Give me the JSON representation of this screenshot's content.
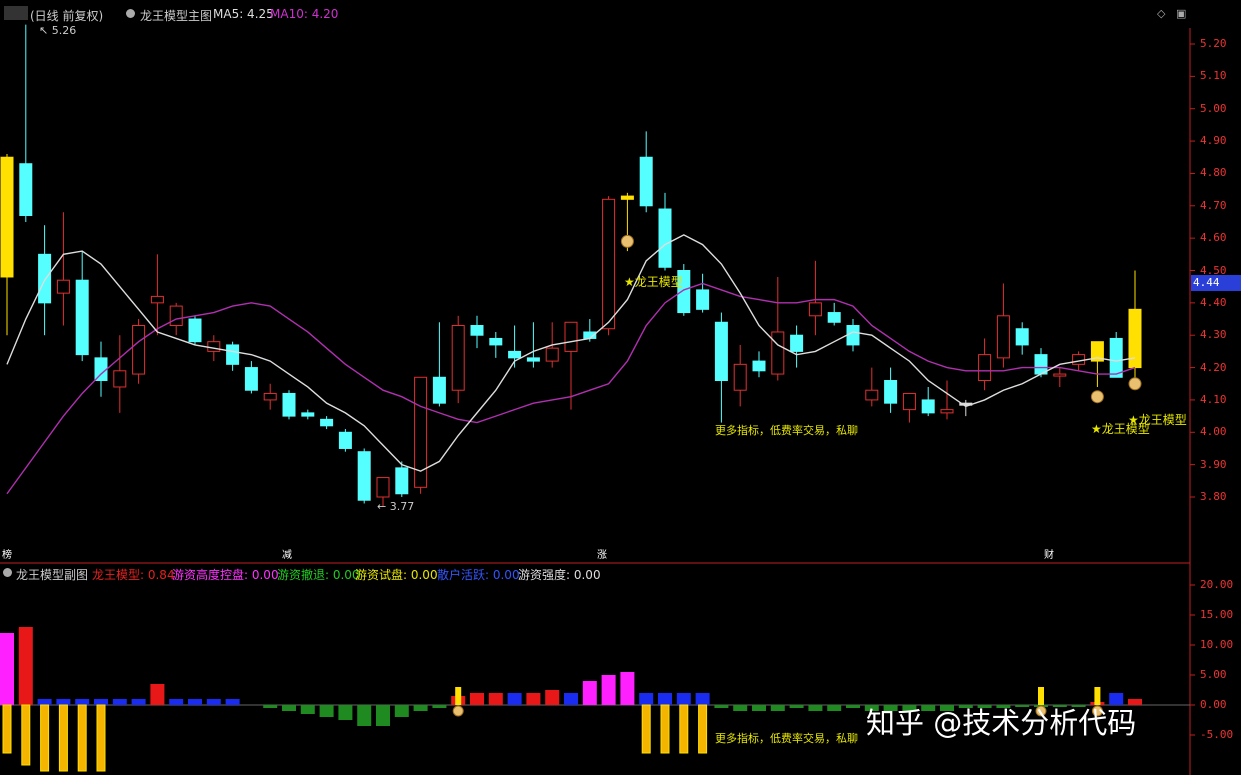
{
  "header": {
    "period_label": "(日线 前复权)",
    "main_chart_title": "龙王模型主图",
    "ma5_label": "MA5: 4.25",
    "ma10_label": "MA10: 4.20"
  },
  "sub_header": {
    "title": "龙王模型副图",
    "items": [
      {
        "label": "龙王模型: 0.84",
        "color": "#e62020"
      },
      {
        "label": "游资高度控盘: 0.00",
        "color": "#ff33ff"
      },
      {
        "label": "游资撤退: 0.00",
        "color": "#22cc22"
      },
      {
        "label": "游资试盘: 0.00",
        "color": "#e6e600"
      },
      {
        "label": "散户活跃: 0.00",
        "color": "#3355ff"
      },
      {
        "label": "游资强度: 0.00",
        "color": "#dddddd"
      }
    ]
  },
  "tags": [
    {
      "text": "榜",
      "color": "#b05050"
    },
    {
      "text": "减",
      "color": "#2e8b2e"
    },
    {
      "text": "涨",
      "color": "#c03030"
    },
    {
      "text": "财",
      "color": "#4a6aa0"
    }
  ],
  "current_price": "4.44",
  "watermark": "知乎 @技术分析代码",
  "annotations": {
    "more_indicators": "更多指标，低费率交易，私聊",
    "dragon_a": "★龙王模型",
    "dragon_b": "★龙王模型",
    "dragon_c": "★龙王模型",
    "high_mark": "5.26",
    "low_mark": "3.77"
  },
  "colors": {
    "up": "#e03030",
    "down": "#55ffff",
    "signal": "#ffe000",
    "ma5": "#dddddd",
    "ma10": "#b030b0",
    "axis": "#c02020"
  },
  "chart_data": [
    {
      "type": "candlestick",
      "title": "龙王模型主图",
      "ylim": [
        3.7,
        5.3
      ],
      "yticks": [
        "5.20",
        "5.10",
        "5.00",
        "4.90",
        "4.80",
        "4.70",
        "4.60",
        "4.50",
        "4.40",
        "4.30",
        "4.20",
        "4.10",
        "4.00",
        "3.90",
        "3.80"
      ],
      "candles": [
        {
          "o": 4.48,
          "h": 4.86,
          "l": 4.3,
          "c": 4.85,
          "k": "signal"
        },
        {
          "o": 4.83,
          "h": 5.26,
          "l": 4.65,
          "c": 4.67,
          "k": "down"
        },
        {
          "o": 4.55,
          "h": 4.64,
          "l": 4.3,
          "c": 4.4,
          "k": "down"
        },
        {
          "o": 4.43,
          "h": 4.68,
          "l": 4.33,
          "c": 4.47,
          "k": "up"
        },
        {
          "o": 4.47,
          "h": 4.56,
          "l": 4.22,
          "c": 4.24,
          "k": "down"
        },
        {
          "o": 4.23,
          "h": 4.28,
          "l": 4.11,
          "c": 4.16,
          "k": "down"
        },
        {
          "o": 4.14,
          "h": 4.3,
          "l": 4.06,
          "c": 4.19,
          "k": "up"
        },
        {
          "o": 4.18,
          "h": 4.35,
          "l": 4.15,
          "c": 4.33,
          "k": "up"
        },
        {
          "o": 4.4,
          "h": 4.55,
          "l": 4.3,
          "c": 4.42,
          "k": "up"
        },
        {
          "o": 4.33,
          "h": 4.4,
          "l": 4.3,
          "c": 4.39,
          "k": "up"
        },
        {
          "o": 4.35,
          "h": 4.36,
          "l": 4.27,
          "c": 4.28,
          "k": "down"
        },
        {
          "o": 4.25,
          "h": 4.3,
          "l": 4.22,
          "c": 4.28,
          "k": "up"
        },
        {
          "o": 4.27,
          "h": 4.28,
          "l": 4.19,
          "c": 4.21,
          "k": "down"
        },
        {
          "o": 4.2,
          "h": 4.22,
          "l": 4.12,
          "c": 4.13,
          "k": "down"
        },
        {
          "o": 4.1,
          "h": 4.15,
          "l": 4.07,
          "c": 4.12,
          "k": "up"
        },
        {
          "o": 4.12,
          "h": 4.13,
          "l": 4.04,
          "c": 4.05,
          "k": "down"
        },
        {
          "o": 4.06,
          "h": 4.07,
          "l": 4.04,
          "c": 4.05,
          "k": "down"
        },
        {
          "o": 4.04,
          "h": 4.05,
          "l": 4.01,
          "c": 4.02,
          "k": "down"
        },
        {
          "o": 4.0,
          "h": 4.01,
          "l": 3.94,
          "c": 3.95,
          "k": "down"
        },
        {
          "o": 3.94,
          "h": 3.95,
          "l": 3.78,
          "c": 3.79,
          "k": "down"
        },
        {
          "o": 3.8,
          "h": 3.86,
          "l": 3.77,
          "c": 3.86,
          "k": "up"
        },
        {
          "o": 3.89,
          "h": 3.91,
          "l": 3.8,
          "c": 3.81,
          "k": "down"
        },
        {
          "o": 3.83,
          "h": 4.17,
          "l": 3.81,
          "c": 4.17,
          "k": "up"
        },
        {
          "o": 4.17,
          "h": 4.34,
          "l": 4.08,
          "c": 4.09,
          "k": "down"
        },
        {
          "o": 4.13,
          "h": 4.36,
          "l": 4.09,
          "c": 4.33,
          "k": "up"
        },
        {
          "o": 4.33,
          "h": 4.36,
          "l": 4.26,
          "c": 4.3,
          "k": "down"
        },
        {
          "o": 4.29,
          "h": 4.31,
          "l": 4.23,
          "c": 4.27,
          "k": "down"
        },
        {
          "o": 4.25,
          "h": 4.33,
          "l": 4.2,
          "c": 4.23,
          "k": "down"
        },
        {
          "o": 4.23,
          "h": 4.34,
          "l": 4.2,
          "c": 4.22,
          "k": "down"
        },
        {
          "o": 4.22,
          "h": 4.34,
          "l": 4.2,
          "c": 4.26,
          "k": "up"
        },
        {
          "o": 4.25,
          "h": 4.34,
          "l": 4.07,
          "c": 4.34,
          "k": "up"
        },
        {
          "o": 4.31,
          "h": 4.35,
          "l": 4.28,
          "c": 4.29,
          "k": "down"
        },
        {
          "o": 4.32,
          "h": 4.73,
          "l": 4.3,
          "c": 4.72,
          "k": "up"
        },
        {
          "o": 4.73,
          "h": 4.74,
          "l": 4.56,
          "c": 4.72,
          "k": "signal"
        },
        {
          "o": 4.85,
          "h": 4.93,
          "l": 4.68,
          "c": 4.7,
          "k": "down"
        },
        {
          "o": 4.69,
          "h": 4.74,
          "l": 4.5,
          "c": 4.51,
          "k": "down"
        },
        {
          "o": 4.5,
          "h": 4.52,
          "l": 4.36,
          "c": 4.37,
          "k": "down"
        },
        {
          "o": 4.44,
          "h": 4.49,
          "l": 4.37,
          "c": 4.38,
          "k": "down"
        },
        {
          "o": 4.34,
          "h": 4.37,
          "l": 4.03,
          "c": 4.16,
          "k": "down"
        },
        {
          "o": 4.13,
          "h": 4.27,
          "l": 4.08,
          "c": 4.21,
          "k": "up"
        },
        {
          "o": 4.22,
          "h": 4.25,
          "l": 4.17,
          "c": 4.19,
          "k": "down"
        },
        {
          "o": 4.18,
          "h": 4.48,
          "l": 4.16,
          "c": 4.31,
          "k": "up"
        },
        {
          "o": 4.3,
          "h": 4.33,
          "l": 4.2,
          "c": 4.25,
          "k": "down"
        },
        {
          "o": 4.36,
          "h": 4.53,
          "l": 4.3,
          "c": 4.4,
          "k": "up"
        },
        {
          "o": 4.37,
          "h": 4.4,
          "l": 4.33,
          "c": 4.34,
          "k": "down"
        },
        {
          "o": 4.33,
          "h": 4.35,
          "l": 4.25,
          "c": 4.27,
          "k": "down"
        },
        {
          "o": 4.1,
          "h": 4.2,
          "l": 4.08,
          "c": 4.13,
          "k": "up"
        },
        {
          "o": 4.16,
          "h": 4.2,
          "l": 4.06,
          "c": 4.09,
          "k": "down"
        },
        {
          "o": 4.07,
          "h": 4.12,
          "l": 4.03,
          "c": 4.12,
          "k": "up"
        },
        {
          "o": 4.1,
          "h": 4.14,
          "l": 4.05,
          "c": 4.06,
          "k": "down"
        },
        {
          "o": 4.06,
          "h": 4.16,
          "l": 4.04,
          "c": 4.07,
          "k": "up"
        },
        {
          "o": 4.09,
          "h": 4.1,
          "l": 4.05,
          "c": 4.09,
          "k": "flat"
        },
        {
          "o": 4.16,
          "h": 4.29,
          "l": 4.13,
          "c": 4.24,
          "k": "up"
        },
        {
          "o": 4.23,
          "h": 4.46,
          "l": 4.2,
          "c": 4.36,
          "k": "up"
        },
        {
          "o": 4.32,
          "h": 4.34,
          "l": 4.24,
          "c": 4.27,
          "k": "down"
        },
        {
          "o": 4.24,
          "h": 4.26,
          "l": 4.17,
          "c": 4.18,
          "k": "down"
        },
        {
          "o": 4.18,
          "h": 4.2,
          "l": 4.14,
          "c": 4.18,
          "k": "up"
        },
        {
          "o": 4.21,
          "h": 4.25,
          "l": 4.19,
          "c": 4.24,
          "k": "up"
        },
        {
          "o": 4.22,
          "h": 4.28,
          "l": 4.14,
          "c": 4.28,
          "k": "signal"
        },
        {
          "o": 4.29,
          "h": 4.31,
          "l": 4.17,
          "c": 4.17,
          "k": "down"
        },
        {
          "o": 4.2,
          "h": 4.5,
          "l": 4.15,
          "c": 4.38,
          "k": "signal"
        }
      ],
      "ma5": [
        4.21,
        4.35,
        4.47,
        4.55,
        4.56,
        4.52,
        4.45,
        4.38,
        4.31,
        4.29,
        4.27,
        4.26,
        4.25,
        4.24,
        4.22,
        4.18,
        4.14,
        4.09,
        4.06,
        4.02,
        3.96,
        3.9,
        3.88,
        3.91,
        3.99,
        4.06,
        4.13,
        4.22,
        4.25,
        4.27,
        4.28,
        4.29,
        4.34,
        4.41,
        4.53,
        4.58,
        4.61,
        4.58,
        4.52,
        4.43,
        4.33,
        4.27,
        4.24,
        4.25,
        4.28,
        4.31,
        4.3,
        4.26,
        4.22,
        4.16,
        4.12,
        4.08,
        4.1,
        4.13,
        4.15,
        4.18,
        4.21,
        4.22,
        4.23,
        4.22,
        4.23
      ],
      "ma10": [
        3.81,
        3.89,
        3.97,
        4.05,
        4.12,
        4.18,
        4.23,
        4.28,
        4.32,
        4.35,
        4.36,
        4.37,
        4.39,
        4.4,
        4.39,
        4.35,
        4.31,
        4.26,
        4.21,
        4.17,
        4.13,
        4.11,
        4.08,
        4.06,
        4.04,
        4.03,
        4.05,
        4.07,
        4.09,
        4.1,
        4.11,
        4.13,
        4.15,
        4.22,
        4.33,
        4.4,
        4.44,
        4.46,
        4.44,
        4.42,
        4.41,
        4.4,
        4.4,
        4.41,
        4.41,
        4.39,
        4.33,
        4.29,
        4.25,
        4.22,
        4.2,
        4.19,
        4.19,
        4.19,
        4.2,
        4.2,
        4.2,
        4.19,
        4.18,
        4.18,
        4.2
      ]
    },
    {
      "type": "bar",
      "title": "龙王模型副图",
      "ylim": [
        -11,
        24
      ],
      "yticks": [
        "20.00",
        "15.00",
        "10.00",
        "5.00",
        "0.00",
        "-5.00"
      ],
      "bars": [
        {
          "v": 12,
          "k": "magenta"
        },
        {
          "v": 13,
          "k": "red"
        },
        {
          "v": 1,
          "k": "blue"
        },
        {
          "v": 1,
          "k": "blue"
        },
        {
          "v": 1,
          "k": "blue"
        },
        {
          "v": 1,
          "k": "blue"
        },
        {
          "v": 1,
          "k": "blue"
        },
        {
          "v": 1,
          "k": "blue"
        },
        {
          "v": 3.5,
          "k": "red"
        },
        {
          "v": 1,
          "k": "blue"
        },
        {
          "v": 1,
          "k": "blue"
        },
        {
          "v": 1,
          "k": "blue"
        },
        {
          "v": 1,
          "k": "blue"
        },
        {
          "v": 0,
          "k": "none"
        },
        {
          "v": -0.5,
          "k": "green"
        },
        {
          "v": -1,
          "k": "green"
        },
        {
          "v": -1.5,
          "k": "green"
        },
        {
          "v": -2,
          "k": "green"
        },
        {
          "v": -2.5,
          "k": "green"
        },
        {
          "v": -3.5,
          "k": "green"
        },
        {
          "v": -3.5,
          "k": "green"
        },
        {
          "v": -2,
          "k": "green"
        },
        {
          "v": -1,
          "k": "green"
        },
        {
          "v": -0.5,
          "k": "green"
        },
        {
          "v": 1.5,
          "k": "red"
        },
        {
          "v": 2,
          "k": "red"
        },
        {
          "v": 2,
          "k": "red"
        },
        {
          "v": 2,
          "k": "blue"
        },
        {
          "v": 2,
          "k": "red"
        },
        {
          "v": 2.5,
          "k": "red"
        },
        {
          "v": 2,
          "k": "blue"
        },
        {
          "v": 4,
          "k": "magenta"
        },
        {
          "v": 5,
          "k": "magenta"
        },
        {
          "v": 5.5,
          "k": "magenta"
        },
        {
          "v": 2,
          "k": "blue"
        },
        {
          "v": 2,
          "k": "blue"
        },
        {
          "v": 2,
          "k": "blue"
        },
        {
          "v": 2,
          "k": "blue"
        },
        {
          "v": -0.5,
          "k": "green"
        },
        {
          "v": -1,
          "k": "green"
        },
        {
          "v": -1,
          "k": "green"
        },
        {
          "v": -1,
          "k": "green"
        },
        {
          "v": -0.5,
          "k": "green"
        },
        {
          "v": -1,
          "k": "green"
        },
        {
          "v": -1,
          "k": "green"
        },
        {
          "v": -0.5,
          "k": "green"
        },
        {
          "v": -1,
          "k": "green"
        },
        {
          "v": -1,
          "k": "green"
        },
        {
          "v": -1,
          "k": "green"
        },
        {
          "v": -1,
          "k": "green"
        },
        {
          "v": -1,
          "k": "green"
        },
        {
          "v": -0.5,
          "k": "green"
        },
        {
          "v": -0.5,
          "k": "green"
        },
        {
          "v": -0.5,
          "k": "green"
        },
        {
          "v": -0.3,
          "k": "green"
        },
        {
          "v": -0.3,
          "k": "green"
        },
        {
          "v": -0.3,
          "k": "green"
        },
        {
          "v": -0.3,
          "k": "green"
        },
        {
          "v": 0.5,
          "k": "red"
        },
        {
          "v": 2,
          "k": "blue"
        },
        {
          "v": 1,
          "k": "red"
        }
      ],
      "negatives": [
        {
          "i": 0,
          "v": -8
        },
        {
          "i": 1,
          "v": -10
        },
        {
          "i": 2,
          "v": -11
        },
        {
          "i": 3,
          "v": -11
        },
        {
          "i": 4,
          "v": -11
        },
        {
          "i": 5,
          "v": -11
        },
        {
          "i": 34,
          "v": -8
        },
        {
          "i": 35,
          "v": -8
        },
        {
          "i": 36,
          "v": -8
        },
        {
          "i": 37,
          "v": -8
        }
      ],
      "markers": [
        {
          "i": 24,
          "v": 3
        },
        {
          "i": 55,
          "v": 3
        },
        {
          "i": 58,
          "v": 3
        }
      ]
    }
  ]
}
